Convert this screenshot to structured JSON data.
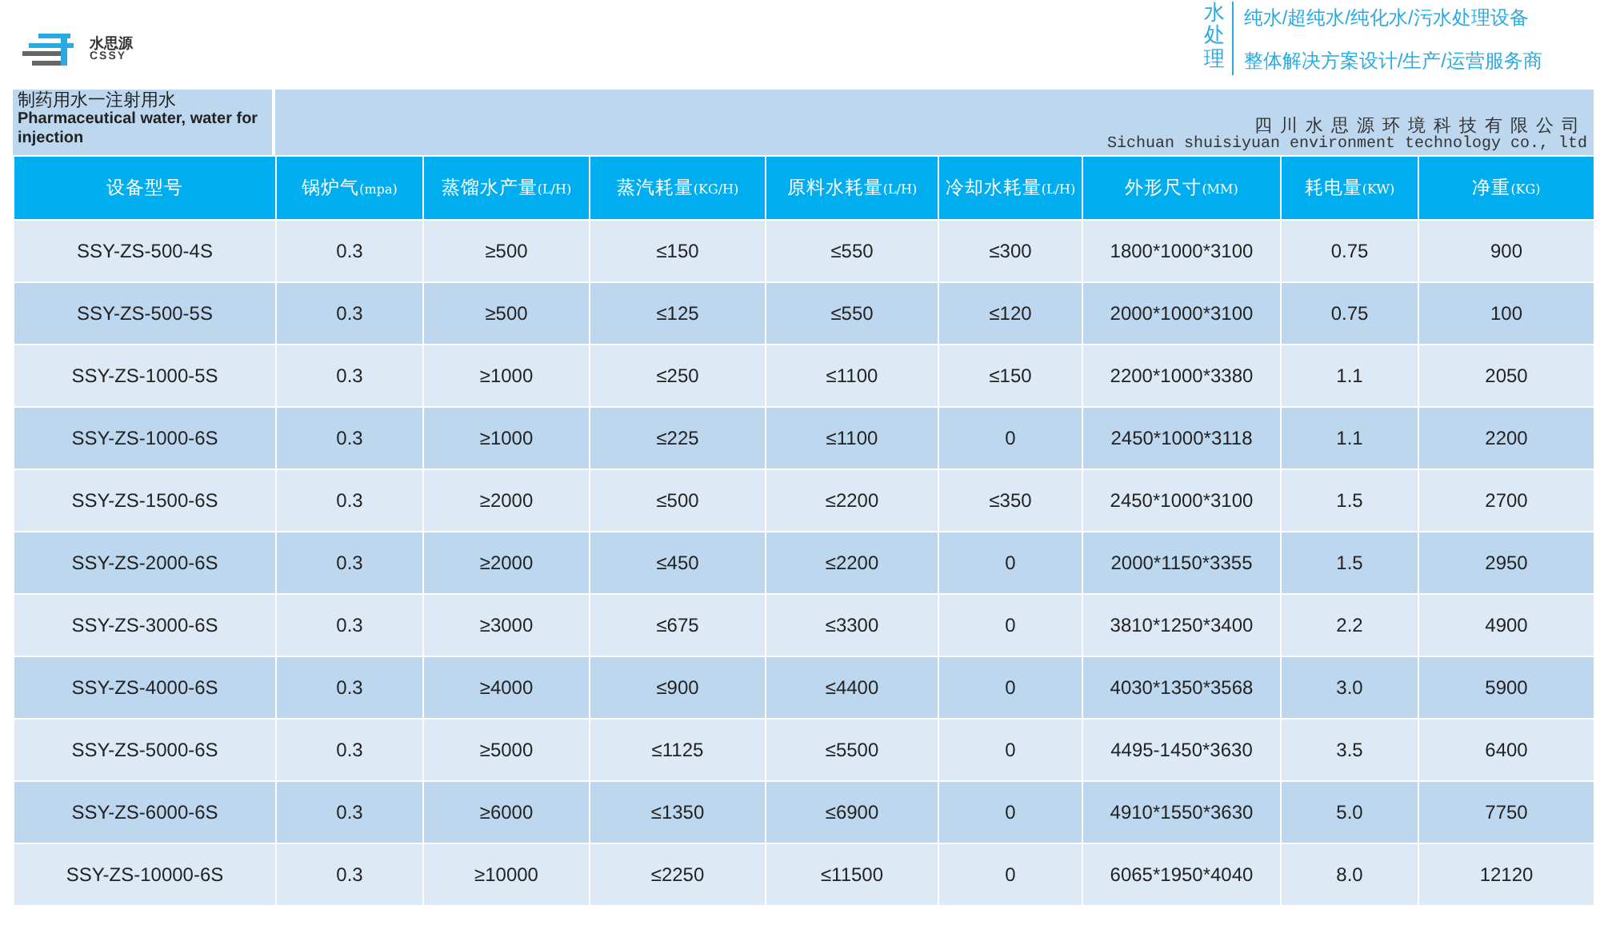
{
  "brand": {
    "name": "水思源",
    "subname": "CSSY"
  },
  "tagline": {
    "vertical": "水处理",
    "lines": [
      "纯水/超纯水/纯化水/污水处理设备",
      "整体解决方案设计/生产/运营服务商"
    ]
  },
  "title": {
    "zh": "制药用水一注射用水",
    "en": "Pharmaceutical water, water for injection",
    "company_zh": "四川水思源环境科技有限公司",
    "company_en": "Sichuan shuisiyuan environment technology co., ltd"
  },
  "table": {
    "columns": [
      {
        "name": "设备型号"
      },
      {
        "name": "锅炉气",
        "unit": "(mpa)"
      },
      {
        "name": "蒸馏水产量",
        "unit": "(L/H)"
      },
      {
        "name": "蒸汽耗量",
        "unit": "(KG/H)"
      },
      {
        "name": "原料水耗量",
        "unit": "(L/H)"
      },
      {
        "name": "冷却水耗量",
        "unit": "(L/H)"
      },
      {
        "name": "外形尺寸",
        "unit": "(MM)"
      },
      {
        "name": "耗电量",
        "unit": "(KW)"
      },
      {
        "name": "净重",
        "unit": "(KG)"
      }
    ],
    "rows": [
      [
        "SSY-ZS-500-4S",
        "0.3",
        "≥500",
        "≤150",
        "≤550",
        "≤300",
        "1800*1000*3100",
        "0.75",
        "900"
      ],
      [
        "SSY-ZS-500-5S",
        "0.3",
        "≥500",
        "≤125",
        "≤550",
        "≤120",
        "2000*1000*3100",
        "0.75",
        "100"
      ],
      [
        "SSY-ZS-1000-5S",
        "0.3",
        "≥1000",
        "≤250",
        "≤1100",
        "≤150",
        "2200*1000*3380",
        "1.1",
        "2050"
      ],
      [
        "SSY-ZS-1000-6S",
        "0.3",
        "≥1000",
        "≤225",
        "≤1100",
        "0",
        "2450*1000*3118",
        "1.1",
        "2200"
      ],
      [
        "SSY-ZS-1500-6S",
        "0.3",
        "≥2000",
        "≤500",
        "≤2200",
        "≤350",
        "2450*1000*3100",
        "1.5",
        "2700"
      ],
      [
        "SSY-ZS-2000-6S",
        "0.3",
        "≥2000",
        "≤450",
        "≤2200",
        "0",
        "2000*1150*3355",
        "1.5",
        "2950"
      ],
      [
        "SSY-ZS-3000-6S",
        "0.3",
        "≥3000",
        "≤675",
        "≤3300",
        "0",
        "3810*1250*3400",
        "2.2",
        "4900"
      ],
      [
        "SSY-ZS-4000-6S",
        "0.3",
        "≥4000",
        "≤900",
        "≤4400",
        "0",
        "4030*1350*3568",
        "3.0",
        "5900"
      ],
      [
        "SSY-ZS-5000-6S",
        "0.3",
        "≥5000",
        "≤1125",
        "≤5500",
        "0",
        "4495-1450*3630",
        "3.5",
        "6400"
      ],
      [
        "SSY-ZS-6000-6S",
        "0.3",
        "≥6000",
        "≤1350",
        "≤6900",
        "0",
        "4910*1550*3630",
        "5.0",
        "7750"
      ],
      [
        "SSY-ZS-10000-6S",
        "0.3",
        "≥10000",
        "≤2250",
        "≤11500",
        "0",
        "6065*1950*4040",
        "8.0",
        "12120"
      ]
    ]
  }
}
